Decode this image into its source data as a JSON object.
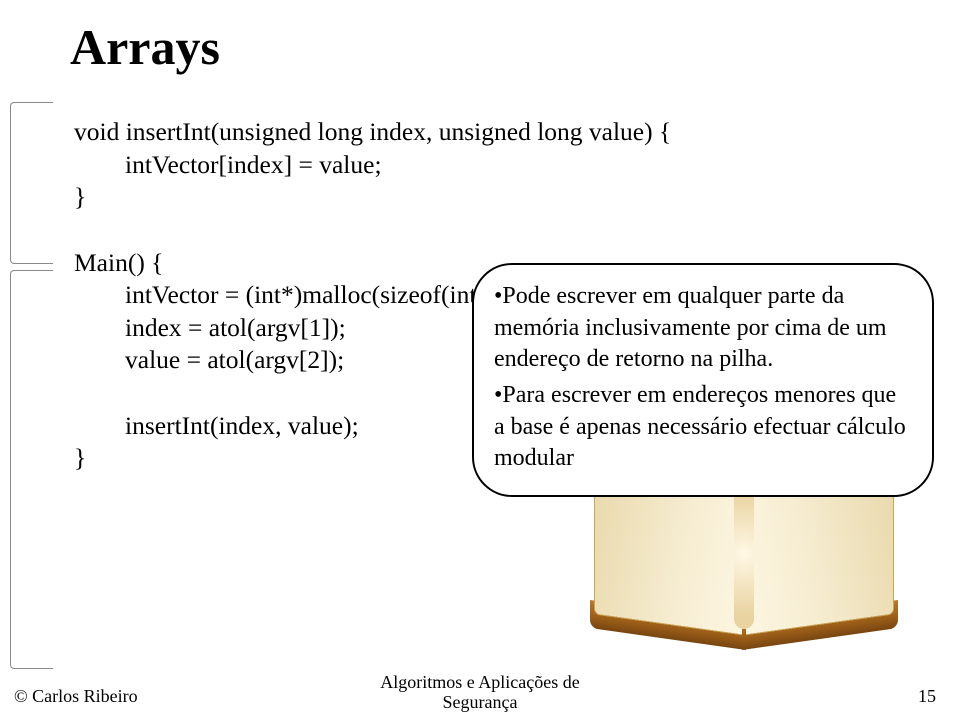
{
  "title": "Arrays",
  "code": {
    "l1": "void insertInt(unsigned long index, unsigned long value) {",
    "l2": "        intVector[index] = value;",
    "l3": "}",
    "l4": "",
    "l5": "Main() {",
    "l6": "        intVector = (int*)malloc(sizeof(int)*0xffff);",
    "l7": "        index = atol(argv[1]);",
    "l8": "        value = atol(argv[2]);",
    "l9": "",
    "l10": "        insertInt(index, value);",
    "l11": "}"
  },
  "callout": {
    "p1": "•Pode escrever em qualquer parte da memória inclusivamente por cima de um endereço de retorno na pilha.",
    "p2": "•Para escrever em endereços menores que a base é apenas necessário efectuar cálculo modular"
  },
  "footer": {
    "left": "© Carlos Ribeiro",
    "center": "Algoritmos e Aplicações de\nSegurança",
    "right": "15"
  }
}
